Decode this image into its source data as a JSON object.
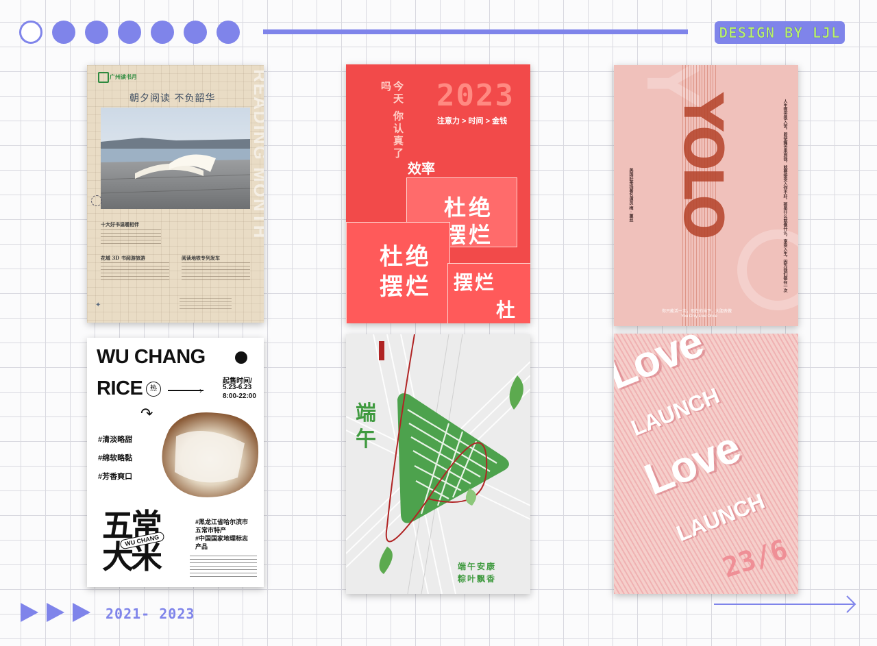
{
  "header": {
    "badge": "DESIGN BY LJL"
  },
  "footer": {
    "years": "2021- 2023"
  },
  "poster1": {
    "brand": "广州读书月",
    "title": "朝夕阅读  不负韶华",
    "vertical": "READING MONTH",
    "sec1": "十大好书温暖相伴",
    "sec2": "花城 3D 书阅游旅游",
    "sec3": "阅读地铁专列发车"
  },
  "poster2": {
    "vertical": "今天 你认真了吗",
    "year": "2023",
    "formula": "注意力 > 时间 > 金钱",
    "efficiency": "效率",
    "block1": "杜绝",
    "block2": "摆烂"
  },
  "poster3": {
    "word": "YOLO",
    "side_left": "美国好莱坞著名演员 梅 · 蕙丝",
    "side_right": "人生很苦很入苦，即使痛苦来到我，就要接受入你不好，那是什么就像什么，享受入生，因为我们都在一次",
    "footer_cn": "你只能活一次，现在的当下，大胆去做",
    "footer_en": "You Only Live Once"
  },
  "poster4": {
    "line1": "WU CHANG",
    "line2": "RICE",
    "hot": "热",
    "sale_label": "起售时间/",
    "sale_dates": "5.23-6.23",
    "sale_time": "8:00-22:00",
    "tags": [
      "#清淡略甜",
      "#绵软略黏",
      "#芳香爽口"
    ],
    "big1": "五常",
    "big2": "大米",
    "swoosh": "WU CHANG",
    "origin1": "#黑龙江省哈尔滨市",
    "origin2": "五常市特产",
    "origin3": "#中国国家地理标志",
    "origin4": "产品"
  },
  "poster5": {
    "title1": "端",
    "title2": "午",
    "blessing1": "端午安康",
    "blessing2": "粽叶飘香"
  },
  "poster6": {
    "love": "Love",
    "launch": "LAUNCH",
    "date": "23/6"
  },
  "colors": {
    "accent": "#7f84ea",
    "badge_text": "#b8f06c",
    "red": "#f24a4a",
    "green": "#3f9a3f"
  }
}
